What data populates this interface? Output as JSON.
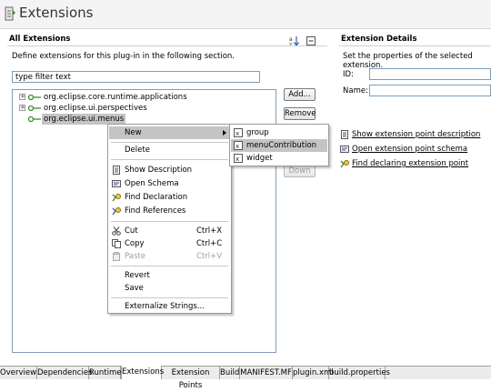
{
  "page": {
    "title": "Extensions"
  },
  "all_extensions": {
    "heading": "All Extensions",
    "description": "Define extensions for this plug-in in the following section.",
    "filter_placeholder": "type filter text",
    "tree": [
      {
        "label": "org.eclipse.core.runtime.applications",
        "expander": "+"
      },
      {
        "label": "org.eclipse.ui.perspectives",
        "expander": "+"
      },
      {
        "label": "org.eclipse.ui.menus",
        "expander": ""
      }
    ],
    "buttons": {
      "add": "Add...",
      "remove": "Remove",
      "down": "Down"
    }
  },
  "context_menu": {
    "items": [
      {
        "label": "New",
        "icon": "none",
        "has_submenu": true
      },
      {
        "label": "Delete",
        "icon": "none"
      },
      {
        "label": "Show Description",
        "icon": "description-icon"
      },
      {
        "label": "Open Schema",
        "icon": "schema-icon"
      },
      {
        "label": "Find Declaration",
        "icon": "find-declaration-icon"
      },
      {
        "label": "Find References",
        "icon": "find-references-icon"
      },
      {
        "label": "Cut",
        "icon": "cut-icon",
        "accelerator": "Ctrl+X"
      },
      {
        "label": "Copy",
        "icon": "copy-icon",
        "accelerator": "Ctrl+C"
      },
      {
        "label": "Paste",
        "icon": "paste-icon",
        "accelerator": "Ctrl+V",
        "disabled": true
      },
      {
        "label": "Revert",
        "icon": "none"
      },
      {
        "label": "Save",
        "icon": "none"
      },
      {
        "label": "Externalize Strings...",
        "icon": "none"
      }
    ]
  },
  "submenu": {
    "items": [
      {
        "label": "group",
        "icon": "element-icon"
      },
      {
        "label": "menuContribution",
        "icon": "element-icon",
        "highlighted": true
      },
      {
        "label": "widget",
        "icon": "element-icon"
      }
    ]
  },
  "extension_details": {
    "heading": "Extension Details",
    "description": "Set the properties of the selected extension.",
    "id_label": "ID:",
    "name_label": "Name:",
    "links": [
      {
        "label": "Show extension point description",
        "icon": "description-icon"
      },
      {
        "label": "Open extension point schema",
        "icon": "schema-icon"
      },
      {
        "label": "Find declaring extension point",
        "icon": "find-declaration-icon"
      }
    ]
  },
  "tabs": [
    "Overview",
    "Dependencies",
    "Runtime",
    "Extensions",
    "Extension Points",
    "Build",
    "MANIFEST.MF",
    "plugin.xml",
    "build.properties"
  ],
  "active_tab": "Extensions",
  "colors": {
    "selection": "#c4c4c4",
    "border": "#7f9db9",
    "section_line": "#c8d2e0",
    "plug_green": "#3c8c2c"
  }
}
